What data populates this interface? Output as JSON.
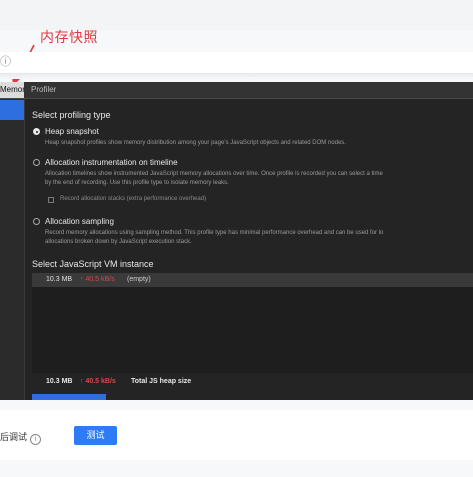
{
  "annotation": {
    "label": "内存快照"
  },
  "header": {
    "info_glyph": "ⓘ"
  },
  "devtools": {
    "tabs": [
      {
        "label": "Memory",
        "active": true
      },
      {
        "label": "Profiler",
        "active": false
      }
    ],
    "profiling": {
      "heading": "Select profiling type",
      "options": [
        {
          "title": "Heap snapshot",
          "selected": true,
          "desc": "Heap snapshot profiles show memory distribution among your page's JavaScript objects and related DOM nodes."
        },
        {
          "title": "Allocation instrumentation on timeline",
          "selected": false,
          "desc1": "Allocation timelines show instrumented JavaScript memory allocations over time. Once profile is recorded you can select a time",
          "desc2": "by the end of recording. Use this profile type to isolate memory leaks.",
          "checkbox_label": "Record allocation stacks (extra performance overhead)"
        },
        {
          "title": "Allocation sampling",
          "selected": false,
          "desc1": "Record memory allocations using sampling method. This profile type has minimal performance overhead and can be used for lo",
          "desc2": "allocations broken down by JavaScript execution stack."
        }
      ]
    },
    "vm": {
      "heading": "Select JavaScript VM instance",
      "rows": [
        {
          "size": "10.3 MB",
          "rate": "↑ 40.5 kB/s",
          "name": "(empty)"
        }
      ],
      "footer": {
        "size": "10.3 MB",
        "rate": "↑ 40.5 kB/s",
        "label": "Total JS heap size"
      }
    }
  },
  "bottom": {
    "after_debug_label": "后调试",
    "info_glyph": "i",
    "test_button": "测试"
  },
  "colors": {
    "accent": "#2d7cf6",
    "annotation": "#e0393e",
    "devtools_bg": "#242424",
    "rate_red": "#d9484c"
  }
}
